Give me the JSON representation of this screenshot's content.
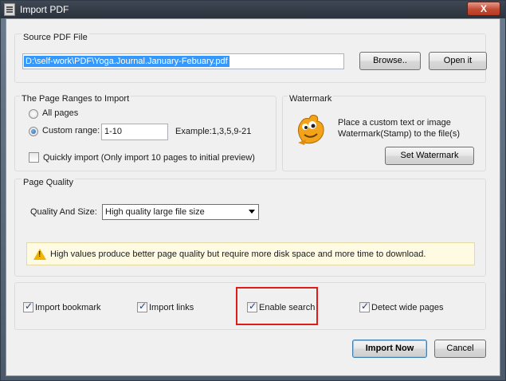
{
  "window": {
    "title": "Import PDF",
    "close_label": "X"
  },
  "source": {
    "group_title": "Source PDF File",
    "path_value": "D:\\self-work\\PDF\\Yoga.Journal.January-Febuary.pdf",
    "browse_label": "Browse..",
    "open_label": "Open it"
  },
  "page_ranges": {
    "group_title": "The Page Ranges to Import",
    "all_pages_label": "All pages",
    "custom_range_label": "Custom range:",
    "custom_range_value": "1-10",
    "example_text": "Example:1,3,5,9-21",
    "quick_import_label": "Quickly import (Only import 10 pages to  initial  preview)",
    "selected": "custom"
  },
  "watermark": {
    "group_title": "Watermark",
    "description_line1": "Place a custom text or image",
    "description_line2": "Watermark(Stamp) to the file(s)",
    "button_label": "Set Watermark"
  },
  "quality": {
    "group_title": "Page Quality",
    "label": "Quality And Size:",
    "selected_option": "High quality large file size",
    "info_text": "High values produce better page quality but require more disk space and more time to download."
  },
  "options": {
    "import_bookmark": "Import bookmark",
    "import_links": "Import links",
    "enable_search": "Enable search",
    "detect_wide_pages": "Detect wide pages"
  },
  "footer": {
    "import_now_label": "Import Now",
    "cancel_label": "Cancel"
  },
  "colors": {
    "accent_selection": "#3399ff",
    "highlight_box": "#e01b1b",
    "info_background": "#fffbe3"
  }
}
